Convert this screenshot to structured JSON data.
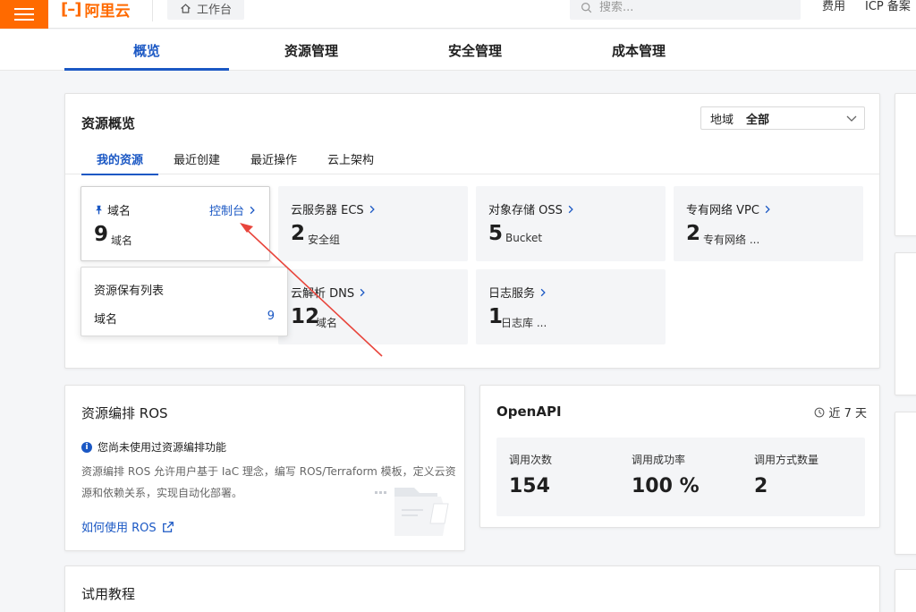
{
  "header": {
    "brand": "阿里云",
    "workbench": "工作台",
    "search_placeholder": "搜索...",
    "links": [
      "费用",
      "ICP 备案"
    ]
  },
  "nav_tabs": [
    {
      "label": "概览",
      "active": true
    },
    {
      "label": "资源管理"
    },
    {
      "label": "安全管理"
    },
    {
      "label": "成本管理"
    }
  ],
  "resource_overview": {
    "title": "资源概览",
    "region_label": "地域",
    "region_value": "全部",
    "tabs": [
      "我的资源",
      "最近创建",
      "最近操作",
      "云上架构"
    ],
    "tiles": [
      {
        "name": "域名",
        "count": "9",
        "unit": "域名",
        "console": "控制台"
      },
      {
        "name": "云服务器 ECS",
        "count": "2",
        "unit": "安全组"
      },
      {
        "name": "对象存储 OSS",
        "count": "5",
        "unit": "Bucket"
      },
      {
        "name": "专有网络 VPC",
        "count": "2",
        "unit": "专有网络 ..."
      },
      {
        "name": "云解析 DNS",
        "count": "12",
        "unit": "域名"
      },
      {
        "name": "日志服务",
        "count": "1",
        "unit": "日志库 ..."
      }
    ],
    "popover": {
      "title": "资源保有列表",
      "item": "域名",
      "count": "9"
    }
  },
  "ros": {
    "title": "资源编排 ROS",
    "info": "您尚未使用过资源编排功能",
    "desc": "资源编排 ROS 允许用户基于 IaC 理念，编写 ROS/Terraform 模板，定义云资源和依赖关系，实现自动化部署。",
    "link": "如何使用 ROS"
  },
  "openapi": {
    "title": "OpenAPI",
    "range": "近 7 天",
    "stats": [
      {
        "label": "调用次数",
        "value": "154"
      },
      {
        "label": "调用成功率",
        "value": "100 %"
      },
      {
        "label": "调用方式数量",
        "value": "2"
      }
    ]
  },
  "tutorial": {
    "title": "试用教程"
  },
  "colors": {
    "brand": "#ff6a00",
    "accent": "#1b58c4",
    "annotation": "#e8453c"
  }
}
